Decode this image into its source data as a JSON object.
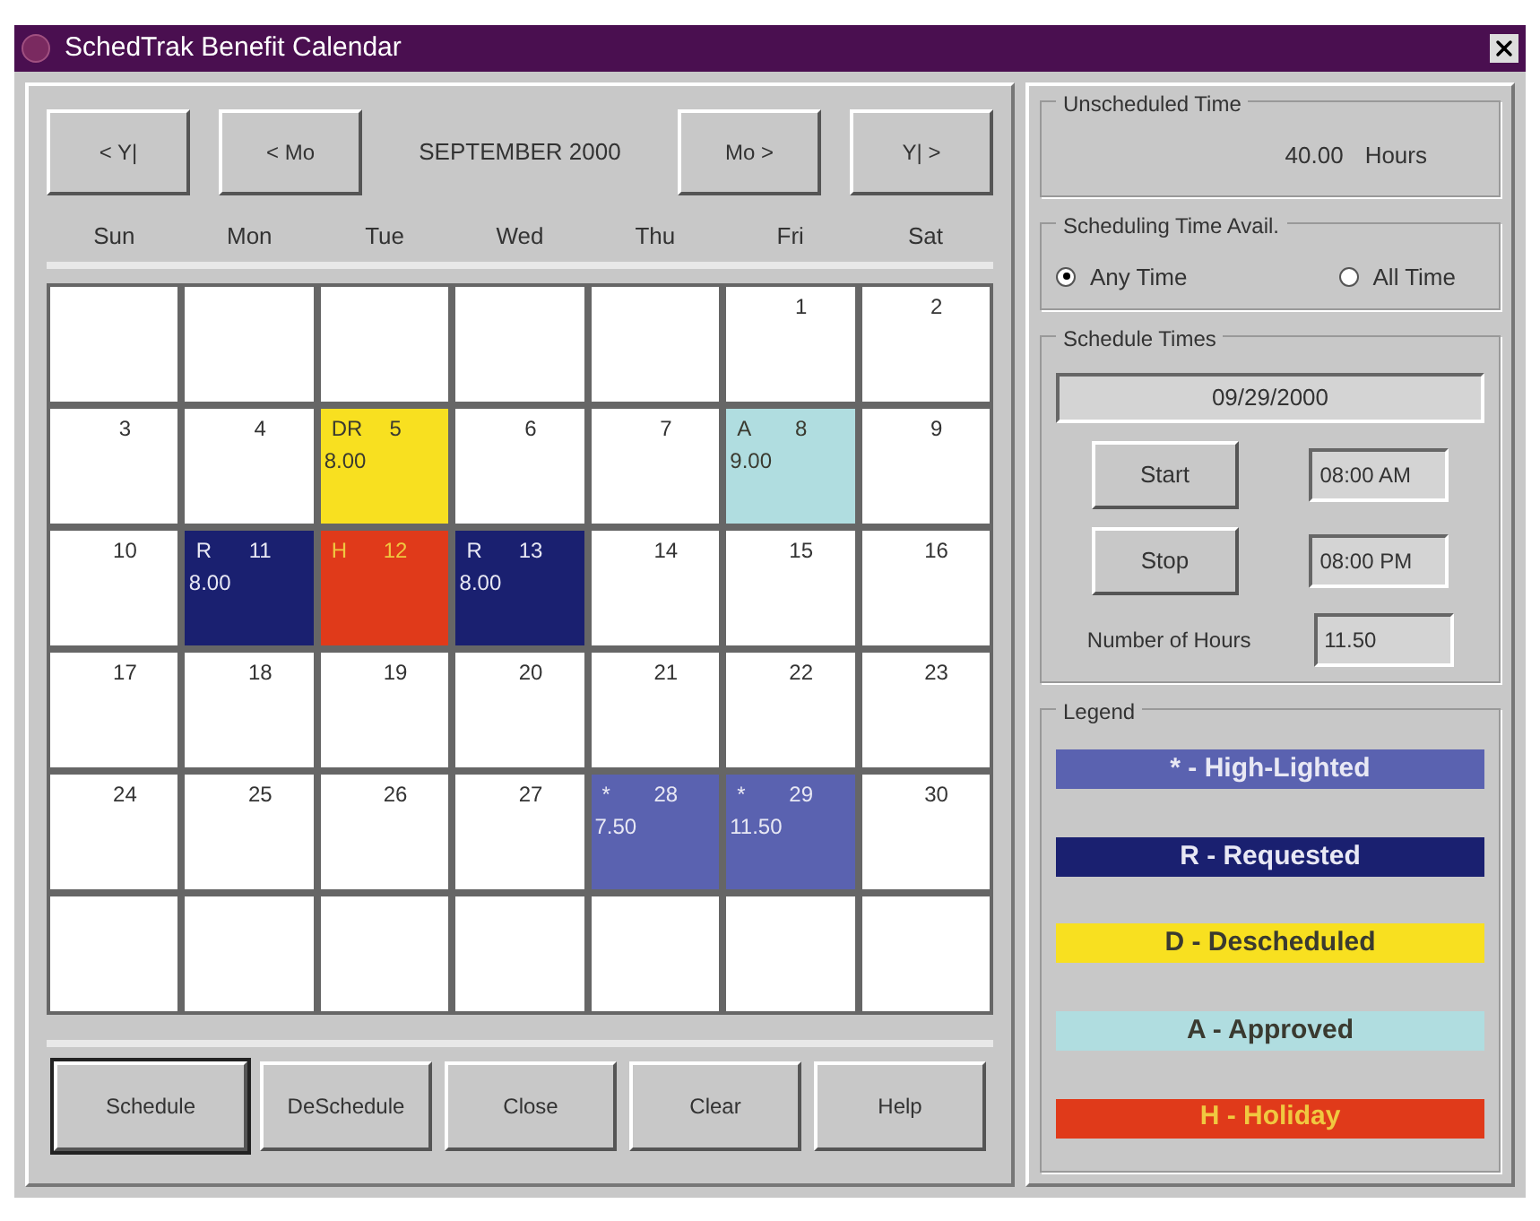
{
  "window": {
    "title": "SchedTrak Benefit Calendar"
  },
  "nav": {
    "prev_year": "< Y|",
    "prev_month": "< Mo",
    "month": "SEPTEMBER 2000",
    "next_month": "Mo >",
    "next_year": "Y| >"
  },
  "weekdays": [
    "Sun",
    "Mon",
    "Tue",
    "Wed",
    "Thu",
    "Fri",
    "Sat"
  ],
  "weeks": [
    [
      {
        "kind": "blank"
      },
      {
        "kind": "blank"
      },
      {
        "kind": "blank"
      },
      {
        "kind": "blank"
      },
      {
        "kind": "blank"
      },
      {
        "kind": "day",
        "day": "1"
      },
      {
        "kind": "day",
        "day": "2"
      }
    ],
    [
      {
        "kind": "day",
        "day": "3"
      },
      {
        "kind": "day",
        "day": "4"
      },
      {
        "kind": "day",
        "day": "5",
        "code": "DR",
        "hours": "8.00",
        "color": "#f8e020"
      },
      {
        "kind": "day",
        "day": "6"
      },
      {
        "kind": "day",
        "day": "7"
      },
      {
        "kind": "day",
        "day": "8",
        "code": "A",
        "hours": "9.00",
        "color": "#b0dde0"
      },
      {
        "kind": "day",
        "day": "9"
      }
    ],
    [
      {
        "kind": "day",
        "day": "10"
      },
      {
        "kind": "day",
        "day": "11",
        "code": "R",
        "hours": "8.00",
        "color": "#1a2070"
      },
      {
        "kind": "day",
        "day": "12",
        "code": "H",
        "color": "#e03a1a"
      },
      {
        "kind": "day",
        "day": "13",
        "code": "R",
        "hours": "8.00",
        "color": "#1a2070"
      },
      {
        "kind": "day",
        "day": "14"
      },
      {
        "kind": "day",
        "day": "15"
      },
      {
        "kind": "day",
        "day": "16"
      }
    ],
    [
      {
        "kind": "day",
        "day": "17"
      },
      {
        "kind": "day",
        "day": "18"
      },
      {
        "kind": "day",
        "day": "19"
      },
      {
        "kind": "day",
        "day": "20"
      },
      {
        "kind": "day",
        "day": "21"
      },
      {
        "kind": "day",
        "day": "22"
      },
      {
        "kind": "day",
        "day": "23"
      }
    ],
    [
      {
        "kind": "day",
        "day": "24"
      },
      {
        "kind": "day",
        "day": "25"
      },
      {
        "kind": "day",
        "day": "26"
      },
      {
        "kind": "day",
        "day": "27"
      },
      {
        "kind": "day",
        "day": "28",
        "code": "*",
        "hours": "7.50",
        "color": "#5a62b0"
      },
      {
        "kind": "day",
        "day": "29",
        "code": "*",
        "hours": "11.50",
        "color": "#5a62b0"
      },
      {
        "kind": "day",
        "day": "30"
      }
    ],
    [
      {
        "kind": "blank"
      },
      {
        "kind": "blank"
      },
      {
        "kind": "blank"
      },
      {
        "kind": "blank"
      },
      {
        "kind": "blank"
      },
      {
        "kind": "blank"
      },
      {
        "kind": "blank"
      }
    ]
  ],
  "buttons": [
    {
      "label": "Schedule",
      "selected": true
    },
    {
      "label": "DeSchedule",
      "selected": false
    },
    {
      "label": "Close",
      "selected": false
    },
    {
      "label": "Clear",
      "selected": false
    },
    {
      "label": "Help",
      "selected": false
    }
  ],
  "unscheduled": {
    "title": "Unscheduled Time",
    "value": "40.00",
    "unit": "Hours"
  },
  "availability": {
    "title": "Scheduling Time Avail.",
    "options": [
      {
        "label": "Any Time",
        "selected": true
      },
      {
        "label": "All Time",
        "selected": false
      }
    ]
  },
  "schedule_times": {
    "title": "Schedule Times",
    "date": "09/29/2000",
    "start_button": "Start",
    "start": "08:00 AM",
    "stop_button": "Stop",
    "stop": "08:00 PM",
    "hours_label": "Number of Hours",
    "hours": "11.50"
  },
  "legend": {
    "title": "Legend",
    "items": [
      {
        "label": "* - High-Lighted",
        "color": "#5a62b0"
      },
      {
        "label": "R - Requested",
        "color": "#1a2070"
      },
      {
        "label": "D - Descheduled",
        "color": "#f8e020"
      },
      {
        "label": "A - Approved",
        "color": "#b0dde0"
      },
      {
        "label": "H - Holiday",
        "color": "#e03a1a"
      }
    ]
  }
}
